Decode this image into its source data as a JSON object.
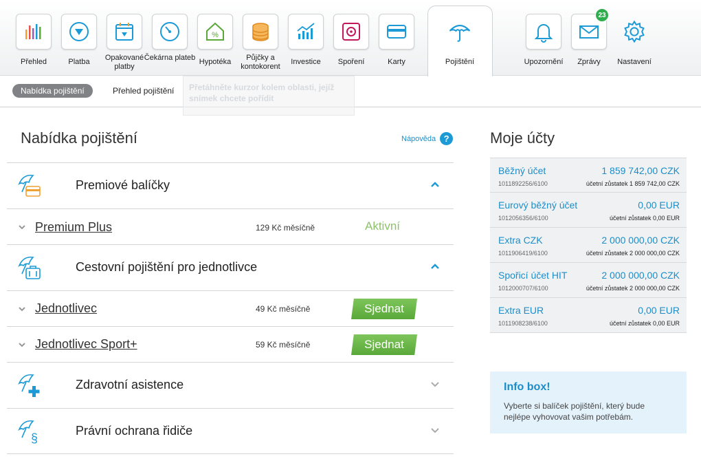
{
  "nav": {
    "items": [
      {
        "label": "Přehled",
        "icon": "chart-bars-icon"
      },
      {
        "label": "Platba",
        "icon": "payment-arrow-icon"
      },
      {
        "label": "Opakované platby",
        "icon": "calendar-icon"
      },
      {
        "label": "Čekárna plateb",
        "icon": "gauge-icon"
      },
      {
        "label": "Hypotéka",
        "icon": "house-percent-icon"
      },
      {
        "label": "Půjčky a kontokorent",
        "icon": "coins-icon"
      },
      {
        "label": "Investice",
        "icon": "growth-chart-icon"
      },
      {
        "label": "Spoření",
        "icon": "safe-icon"
      },
      {
        "label": "Karty",
        "icon": "card-icon"
      },
      {
        "label": "Pojištění",
        "icon": "umbrella-icon"
      },
      {
        "label": "Upozornění",
        "icon": "bell-icon"
      },
      {
        "label": "Zprávy",
        "icon": "envelope-icon"
      },
      {
        "label": "Nastavení",
        "icon": "gear-icon"
      }
    ],
    "messages_badge": "23"
  },
  "subnav": {
    "active": "Nabídka pojištění",
    "link": "Přehled pojištění",
    "ghost_tooltip": "Přetáhněte kurzor kolem oblasti, jejíž snímek chcete pořídit"
  },
  "main": {
    "title": "Nabídka pojištění",
    "help_label": "Nápověda",
    "help_symbol": "?",
    "sections": [
      {
        "title": "Premiové balíčky",
        "icon": "umbrella-card-icon"
      },
      {
        "title": "Cestovní pojištění pro jednotlivce",
        "icon": "umbrella-luggage-icon"
      },
      {
        "title": "Zdravotní asistence",
        "icon": "umbrella-plus-icon"
      },
      {
        "title": "Právní ochrana řidiče",
        "icon": "umbrella-paragraph-icon"
      }
    ],
    "products": [
      {
        "name": "Premium Plus",
        "price": "129 Kč měsíčně",
        "status": "Aktivní"
      },
      {
        "name": "Jednotlivec",
        "price": "49 Kč měsíčně",
        "button": "Sjednat"
      },
      {
        "name": "Jednotlivec Sport+",
        "price": "59 Kč měsíčně",
        "button": "Sjednat"
      }
    ]
  },
  "accounts": {
    "title": "Moje účty",
    "items": [
      {
        "name": "Běžný účet",
        "number": "1011892256/6100",
        "balance": "1 859 742,00 CZK",
        "sub": "účetní zůstatek 1 859 742,00 CZK"
      },
      {
        "name": "Eurový běžný účet",
        "number": "1012056356/6100",
        "balance": "0,00 EUR",
        "sub": "účetní zůstatek 0,00 EUR"
      },
      {
        "name": "Extra CZK",
        "number": "1011906419/6100",
        "balance": "2 000 000,00 CZK",
        "sub": "účetní zůstatek 2 000 000,00 CZK"
      },
      {
        "name": "Spořicí účet HIT",
        "number": "1012000707/6100",
        "balance": "2 000 000,00 CZK",
        "sub": "účetní zůstatek 2 000 000,00 CZK"
      },
      {
        "name": "Extra EUR",
        "number": "1011908238/6100",
        "balance": "0,00 EUR",
        "sub": "účetní zůstatek 0,00 EUR"
      }
    ]
  },
  "infobox": {
    "title": "Info box!",
    "text": "Vyberte si balíček pojištění, který bude nejlépe vyhovovat vašim potřebám."
  },
  "colors": {
    "accent_blue": "#1b8ec9",
    "active_green": "#8cc269",
    "button_green": "#5aa83a",
    "badge_green": "#2fae4e",
    "info_bg": "#e4f2fb"
  }
}
